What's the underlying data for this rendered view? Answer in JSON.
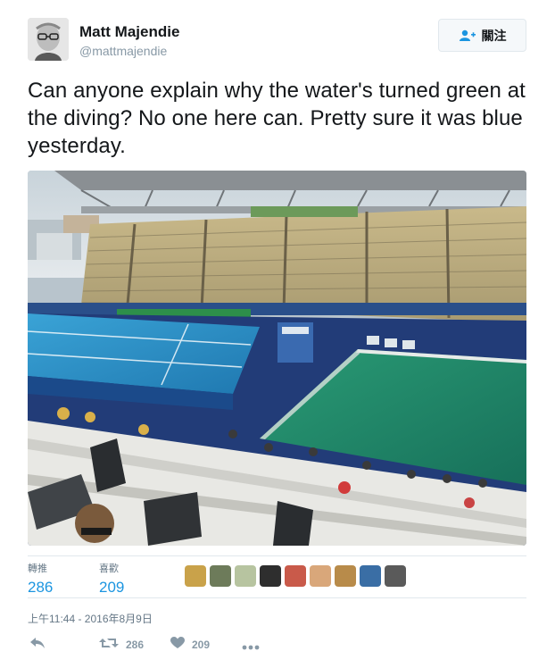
{
  "user": {
    "name": "Matt Majendie",
    "handle": "@mattmajendie"
  },
  "follow_button": {
    "label": "關注",
    "icon": "add-user-icon"
  },
  "tweet": {
    "text": "Can anyone explain why the water's turned green at the diving? No one here can. Pretty sure it was blue yesterday."
  },
  "photo": {
    "subject": "stadium-pools-photo"
  },
  "stats": {
    "retweets_label": "轉推",
    "retweets_value": "286",
    "likes_label": "喜歡",
    "likes_value": "209"
  },
  "likers": {
    "count": 9,
    "colors": [
      "#c9a24a",
      "#6d7b5a",
      "#b7c4a0",
      "#2e2e2e",
      "#c95a4a",
      "#d9a77a",
      "#b88b4a",
      "#3a6ea5",
      "#5a5a5a"
    ]
  },
  "timestamp": "上午11:44 - 2016年8月9日",
  "actions": {
    "reply_icon": "reply-icon",
    "retweet_icon": "retweet-icon",
    "retweet_count": "286",
    "like_icon": "heart-icon",
    "like_count": "209",
    "more_icon": "more-icon"
  },
  "colors": {
    "link_blue": "#1b95e0",
    "muted": "#8899a6",
    "border": "#e1e8ed",
    "pool_blue": "#2d8fc4",
    "pool_green": "#1f8a68"
  }
}
